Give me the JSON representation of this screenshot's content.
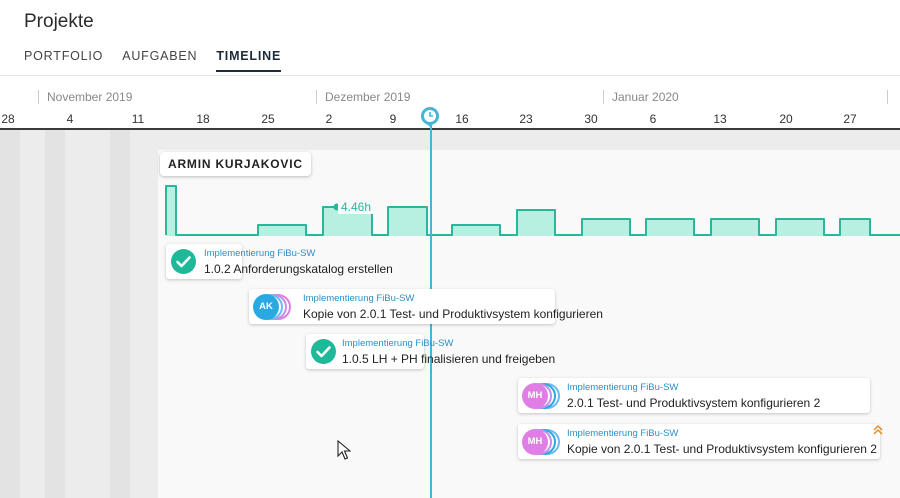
{
  "header": {
    "title": "Projekte",
    "tabs": [
      {
        "label": "PORTFOLIO",
        "active": false
      },
      {
        "label": "AUFGABEN",
        "active": false
      },
      {
        "label": "TIMELINE",
        "active": true
      }
    ]
  },
  "timescale": {
    "months": [
      "November 2019",
      "Dezember 2019",
      "Januar 2020"
    ],
    "days": [
      "28",
      "4",
      "11",
      "18",
      "25",
      "2",
      "9",
      "16",
      "23",
      "30",
      "6",
      "13",
      "20",
      "27"
    ]
  },
  "today_marker": {
    "icon": "clock-icon",
    "color": "#46b6d6"
  },
  "person": {
    "name": "ARMIN KURJAKOVIC"
  },
  "workload": {
    "peak_label": "4.46h",
    "color": "#2bb59a",
    "fill": "#b7f0e0"
  },
  "tasks": [
    {
      "project": "Implementierung FiBu-SW",
      "name": "1.0.2 Anforderungskatalog erstellen",
      "status": "done"
    },
    {
      "project": "Implementierung FiBu-SW",
      "name": "Kopie von 2.0.1 Test- und Produktivsystem konfigurieren",
      "avatar": "AK",
      "avatar_color": "#2aa9e0"
    },
    {
      "project": "Implementierung FiBu-SW",
      "name": "1.0.5 LH + PH finalisieren und freigeben",
      "status": "done"
    },
    {
      "project": "Implementierung FiBu-SW",
      "name": "2.0.1 Test- und Produktivsystem konfigurieren 2",
      "avatar": "MH",
      "avatar_color": "#e07ee6"
    },
    {
      "project": "Implementierung FiBu-SW",
      "name": "Kopie von 2.0.1 Test- und Produktivsystem konfigurieren 2",
      "avatar": "MH",
      "avatar_color": "#e07ee6"
    }
  ],
  "icons": {
    "check": "check-icon",
    "collapse": "chevron-double-up-icon",
    "cursor": "mouse-cursor-icon"
  }
}
